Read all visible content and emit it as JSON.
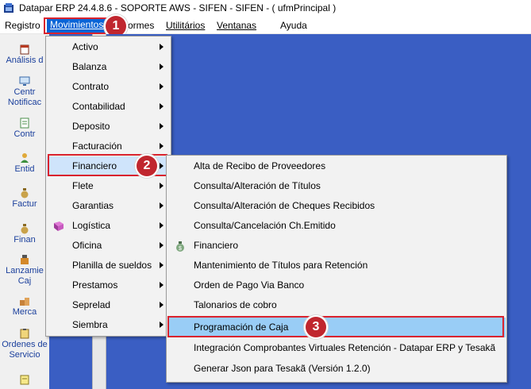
{
  "window": {
    "title": "Datapar ERP 24.4.8.6 - SOPORTE AWS - SIFEN - SIFEN -  ( ufmPrincipal )"
  },
  "menubar": {
    "items": [
      {
        "label": "Registro"
      },
      {
        "label": "Movimientos"
      },
      {
        "label": "ormes"
      },
      {
        "label": "Utilitários"
      },
      {
        "label": "Ventanas"
      },
      {
        "label": "Ayuda"
      }
    ]
  },
  "sidebar": {
    "items": [
      {
        "label": "Análisis d",
        "icon": "calendar-icon"
      },
      {
        "label": "Centr",
        "label2": "Notificac",
        "icon": "monitor-icon"
      },
      {
        "label": "Contr",
        "icon": "document-icon"
      },
      {
        "label": "Entid",
        "icon": "person-icon"
      },
      {
        "label": "Factur",
        "icon": "money-bag-icon"
      },
      {
        "label": "Finan",
        "icon": "money-bag-icon"
      },
      {
        "label": "Lanzamie",
        "label2": "Caj",
        "icon": "cash-register-icon"
      },
      {
        "label": "Merca",
        "icon": "boxes-icon"
      },
      {
        "label": "Ordenes de",
        "label2": "Servicio",
        "icon": "clipboard-icon"
      },
      {
        "label": "",
        "icon": "notepad-icon"
      }
    ]
  },
  "movimientos_menu": {
    "items": [
      {
        "label": "Activo"
      },
      {
        "label": "Balanza"
      },
      {
        "label": "Contrato"
      },
      {
        "label": "Contabilidad"
      },
      {
        "label": "Deposito"
      },
      {
        "label": "Facturación"
      },
      {
        "label": "Financiero"
      },
      {
        "label": "Flete"
      },
      {
        "label": "Garantias"
      },
      {
        "label": "Logística"
      },
      {
        "label": "Oficina"
      },
      {
        "label": "Planilla de sueldos"
      },
      {
        "label": "Prestamos"
      },
      {
        "label": "Seprelad"
      },
      {
        "label": "Siembra"
      }
    ]
  },
  "financiero_menu": {
    "items": [
      {
        "label": "Alta de Recibo de Proveedores"
      },
      {
        "label": "Consulta/Alteración de Títulos"
      },
      {
        "label": "Consulta/Alteración de Cheques Recibidos"
      },
      {
        "label": "Consulta/Cancelación Ch.Emitido"
      },
      {
        "label": "Financiero"
      },
      {
        "label": "Mantenimiento de Títulos para Retención"
      },
      {
        "label": "Orden de Pago Via Banco"
      },
      {
        "label": "Talonarios de cobro"
      },
      {
        "label": "Programación de Caja"
      },
      {
        "label": "Integración Comprobantes Virtuales Retención - Datapar ERP y Tesakã"
      },
      {
        "label": "Generar Json para Tesakã (Versión 1.2.0)"
      }
    ]
  },
  "badges": {
    "one": "1",
    "two": "2",
    "three": "3"
  },
  "colors": {
    "highlight": "#0a64d6",
    "annotation_red": "#c0262e",
    "desktop": "#3a5ec3",
    "hover": "#99cdf6"
  }
}
